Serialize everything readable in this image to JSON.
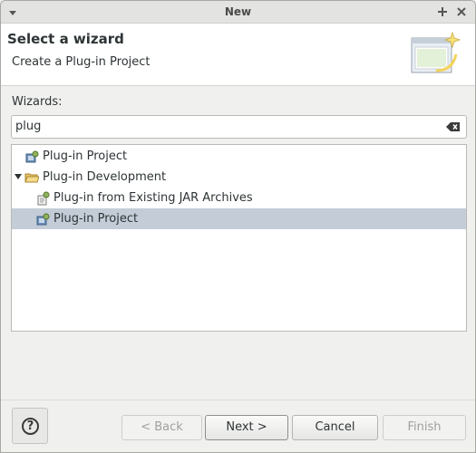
{
  "window": {
    "title": "New",
    "menu_icon": "chevron-down-icon",
    "maximize_icon": "plus-icon",
    "close_icon": "close-icon"
  },
  "header": {
    "title": "Select a wizard",
    "description": "Create a Plug-in Project",
    "image_icon": "new-wizard-banner-icon"
  },
  "wizards": {
    "label": "Wizards:",
    "filter_value": "plug",
    "clear_icon": "clear-text-icon",
    "tree": [
      {
        "label": "Plug-in Project",
        "icon": "plugin-project-icon",
        "indent": 0,
        "selected": false
      },
      {
        "label": "Plug-in Development",
        "icon": "folder-open-icon",
        "indent": 0,
        "expanded": true,
        "selected": false
      },
      {
        "label": "Plug-in from Existing JAR Archives",
        "icon": "plugin-jar-icon",
        "indent": 1,
        "selected": false
      },
      {
        "label": "Plug-in Project",
        "icon": "plugin-project-icon",
        "indent": 1,
        "selected": true
      }
    ]
  },
  "footer": {
    "help_icon": "help-icon",
    "help_glyph": "?",
    "back_label": "< Back",
    "next_label": "Next >",
    "cancel_label": "Cancel",
    "finish_label": "Finish"
  },
  "colors": {
    "selection": "#c3ccd7",
    "header_bg": "#ffffff",
    "window_bg": "#f0f0ef"
  }
}
